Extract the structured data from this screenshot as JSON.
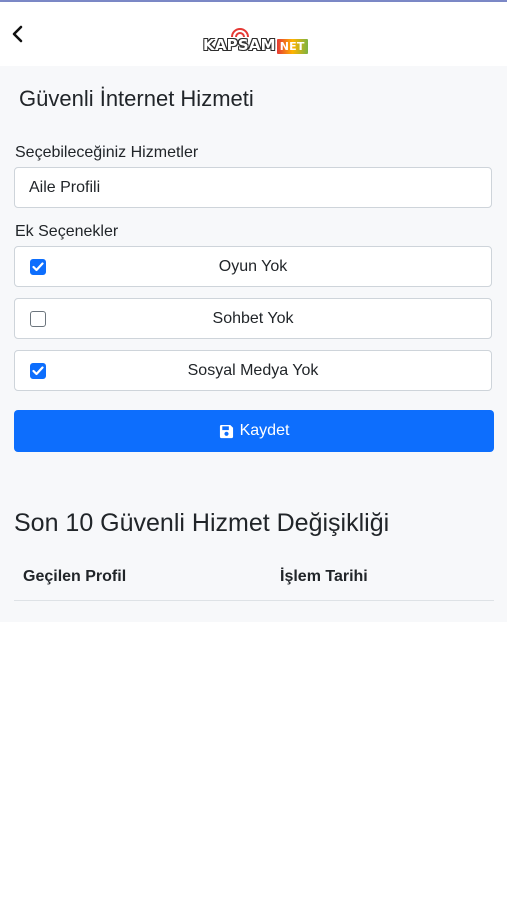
{
  "header": {
    "back_icon": "chevron-left-icon",
    "logo": {
      "part1": "KAPSAM",
      "part2": "NET"
    }
  },
  "page": {
    "title": "Güvenli İnternet Hizmeti"
  },
  "form": {
    "services_label": "Seçebileceğiniz Hizmetler",
    "selected_service": "Aile Profili",
    "extras_label": "Ek Seçenekler",
    "options": [
      {
        "label": "Oyun Yok",
        "checked": true
      },
      {
        "label": "Sohbet Yok",
        "checked": false
      },
      {
        "label": "Sosyal Medya Yok",
        "checked": true
      }
    ],
    "save_label": "Kaydet",
    "save_icon": "floppy-disk-icon"
  },
  "history": {
    "title": "Son 10 Güvenli Hizmet Değişikliği",
    "columns": [
      "Geçilen Profil",
      "İşlem Tarihi"
    ],
    "rows": []
  },
  "colors": {
    "primary": "#0d6efd",
    "content_bg": "#f7f8fa",
    "border": "#ced4da"
  }
}
